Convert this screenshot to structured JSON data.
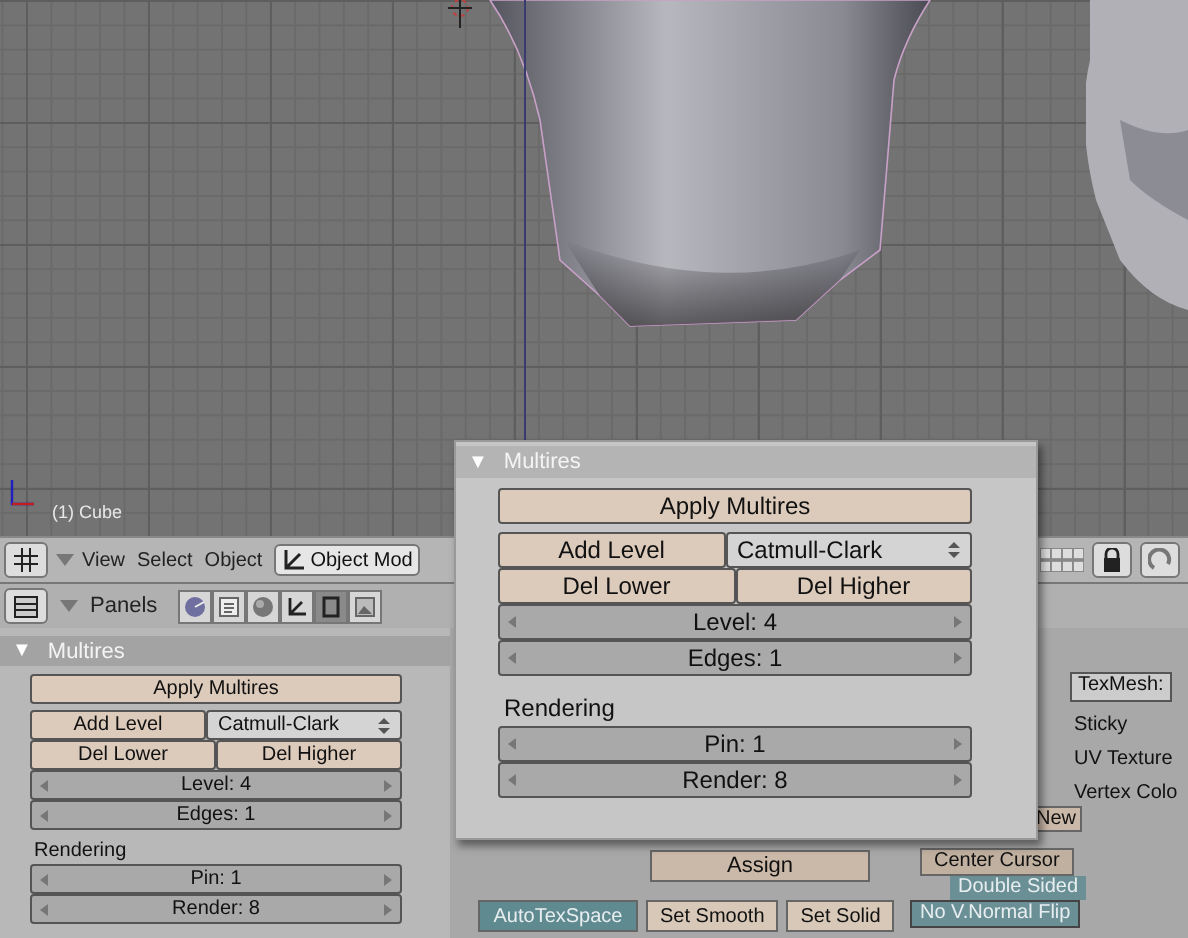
{
  "viewport": {
    "object_label": "(1) Cube"
  },
  "view3d_header": {
    "menus": [
      "View",
      "Select",
      "Object"
    ],
    "mode": "Object Mod"
  },
  "buttons_header": {
    "label": "Panels",
    "tabs": [
      {
        "kind": "logic",
        "selected": false
      },
      {
        "kind": "script",
        "selected": false
      },
      {
        "kind": "shading",
        "selected": false
      },
      {
        "kind": "object",
        "selected": false
      },
      {
        "kind": "editing",
        "selected": true
      },
      {
        "kind": "scene",
        "selected": false
      }
    ]
  },
  "multires_panel": {
    "toggle": "▼",
    "title": "Multires",
    "rows": [
      [
        {
          "kind": "button",
          "label": "Apply Multires"
        }
      ],
      [
        {
          "kind": "button",
          "label": "Add Level"
        },
        {
          "kind": "menu",
          "label": "Catmull-Clark"
        }
      ],
      [
        {
          "kind": "button",
          "label": "Del Lower"
        },
        {
          "kind": "button",
          "label": "Del Higher"
        }
      ],
      [
        {
          "kind": "number",
          "label": "Level: 4"
        }
      ],
      [
        {
          "kind": "number",
          "label": "Edges: 1"
        }
      ],
      [
        {
          "kind": "heading",
          "label": "Rendering"
        }
      ],
      [
        {
          "kind": "number",
          "label": "Pin: 1"
        }
      ],
      [
        {
          "kind": "number",
          "label": "Render: 8"
        }
      ]
    ]
  },
  "mesh_panel": {
    "texmesh_label": "TexMesh:",
    "layers": [
      "Sticky",
      "UV Texture",
      "Vertex Colo"
    ],
    "new_button": "New"
  },
  "link_panel": {
    "assign": "Assign",
    "center": "Center Cursor",
    "double_sided": "Double Sided",
    "normal_flip": "No V.Normal Flip"
  },
  "bottom_buttons": [
    {
      "label": "AutoTexSpace",
      "on": true
    },
    {
      "label": "Set Smooth",
      "on": false
    },
    {
      "label": "Set Solid",
      "on": false
    }
  ],
  "popup": {
    "multires_panel": {
      "toggle": "▼",
      "title": "Multires",
      "rows": [
        [
          {
            "kind": "button",
            "label": "Apply Multires"
          }
        ],
        [
          {
            "kind": "button",
            "label": "Add Level"
          },
          {
            "kind": "menu",
            "label": "Catmull-Clark"
          }
        ],
        [
          {
            "kind": "button",
            "label": "Del Lower"
          },
          {
            "kind": "button",
            "label": "Del Higher"
          }
        ],
        [
          {
            "kind": "number",
            "label": "Level: 4"
          }
        ],
        [
          {
            "kind": "number",
            "label": "Edges: 1"
          }
        ],
        [
          {
            "kind": "heading",
            "label": "Rendering"
          }
        ],
        [
          {
            "kind": "number",
            "label": "Pin: 1"
          }
        ],
        [
          {
            "kind": "number",
            "label": "Render: 8"
          }
        ]
      ]
    }
  }
}
